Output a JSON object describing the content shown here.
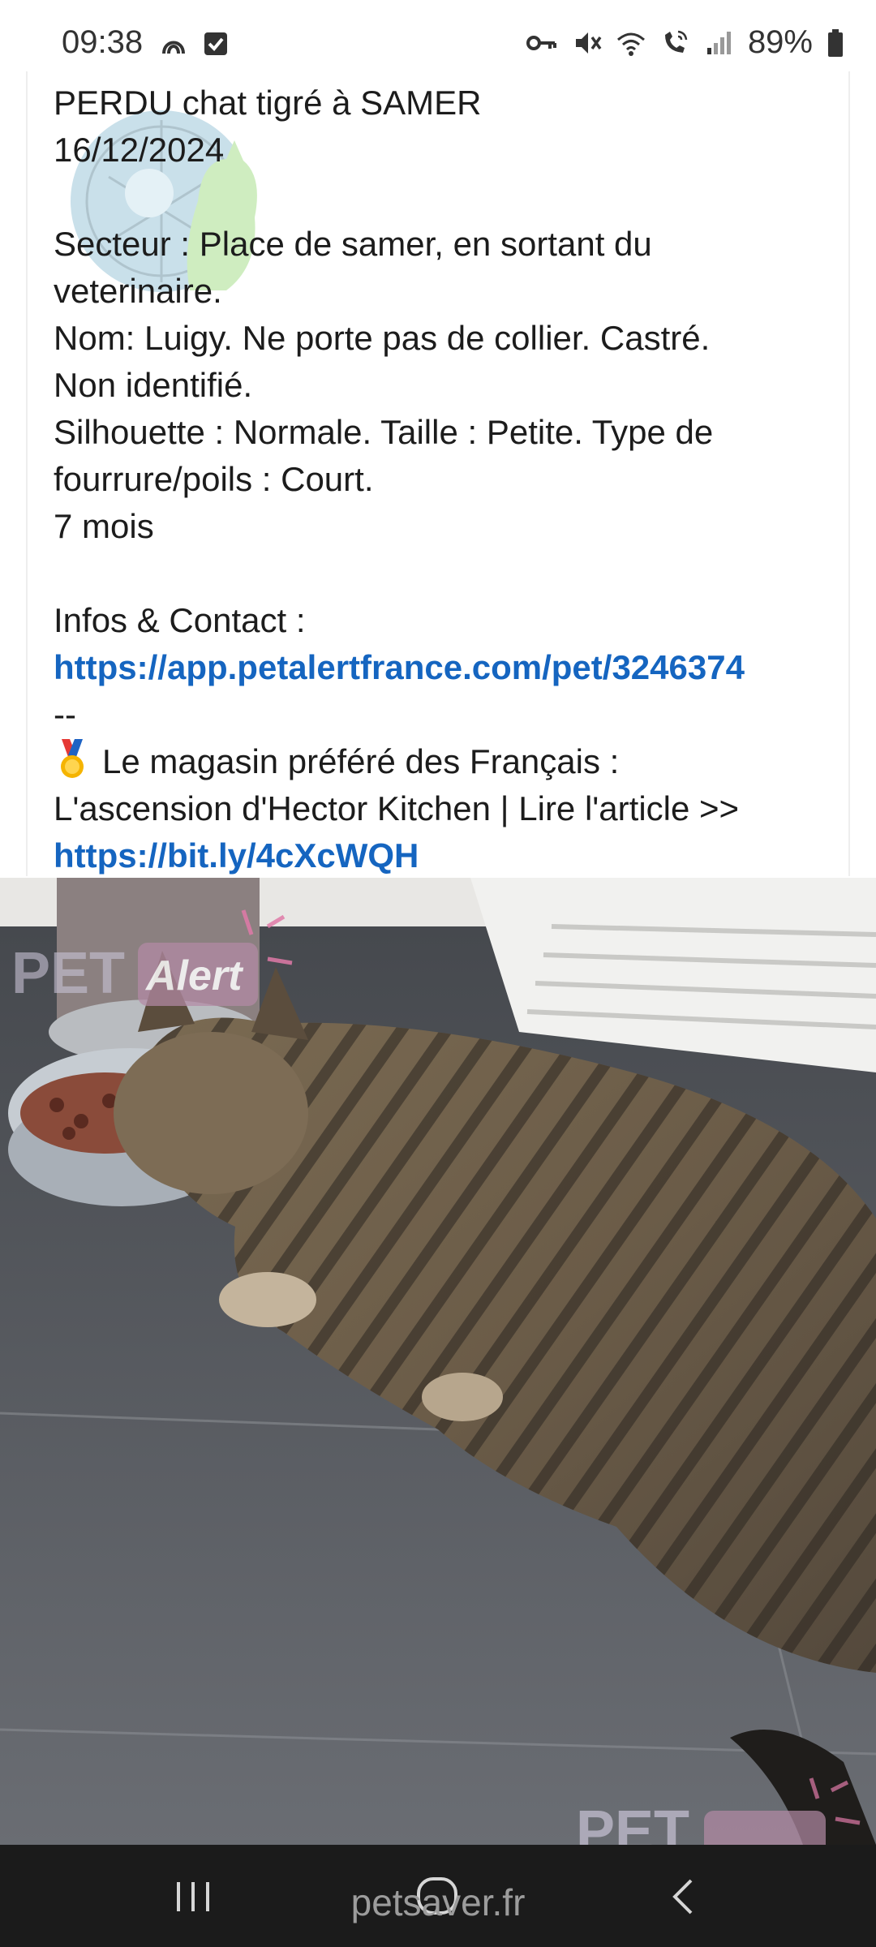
{
  "status_bar": {
    "time": "09:38",
    "battery": "89%",
    "icons": [
      "signal-tower-icon",
      "checkbox-notification-icon",
      "key-icon",
      "mute-icon",
      "wifi-icon",
      "wifi-call-icon",
      "cell-signal-icon",
      "battery-icon"
    ]
  },
  "post": {
    "title": "PERDU chat tigré à SAMER",
    "date": "16/12/2024",
    "sector_line1": "Secteur : Place de samer, en sortant du",
    "sector_line2": "veterinaire.",
    "name_line1": "Nom: Luigy. Ne porte pas de collier. Castré.",
    "name_line2": "Non identifié.",
    "silhouette_line1": "Silhouette : Normale. Taille : Petite. Type de",
    "silhouette_line2": "fourrure/poils : Court.",
    "age": "7 mois",
    "contact_label": "Infos & Contact :",
    "contact_link": "https://app.petalertfrance.com/pet/3246374",
    "separator": "--",
    "promo_line1": "Le magasin préféré des Français :",
    "promo_line2": "L'ascension d'Hector Kitchen | Lire l'article >>",
    "promo_link": "https://bit.ly/4cXcWQH"
  },
  "photo": {
    "watermark_top": "PET Alert",
    "watermark_bottom": "PET Alert"
  },
  "footer": {
    "site": "petsaver.fr"
  },
  "colors": {
    "link": "#1565c0",
    "navbar": "#1b1b1b",
    "accent_pink": "#e07aa8"
  }
}
